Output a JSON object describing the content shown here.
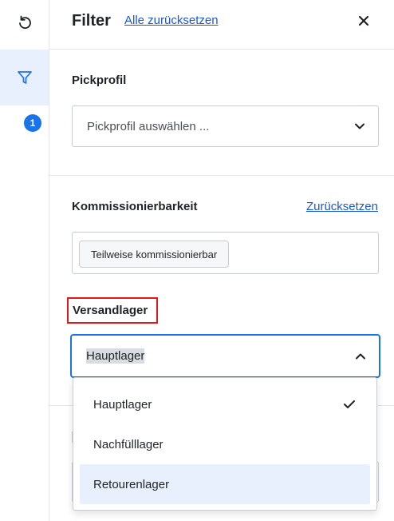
{
  "rail": {
    "undo_icon": "undo-icon",
    "filter_icon": "filter-icon",
    "filter_badge": "1"
  },
  "header": {
    "title": "Filter",
    "reset_all": "Alle zurücksetzen",
    "close_icon": "close-icon"
  },
  "pickprofil": {
    "label": "Pickprofil",
    "placeholder": "Pickprofil auswählen ..."
  },
  "kommissionierbarkeit": {
    "label": "Kommissionierbarkeit",
    "reset": "Zurücksetzen",
    "chip": "Teilweise kommissionierbar"
  },
  "versandlager": {
    "label": "Versandlager",
    "selected": "Hauptlager",
    "options": [
      {
        "label": "Hauptlager",
        "selected": true
      },
      {
        "label": "Nachfülllager",
        "selected": false
      },
      {
        "label": "Retourenlager",
        "selected": false
      }
    ]
  },
  "colors": {
    "accent": "#1a73e8",
    "link": "#1a56db",
    "highlight_border": "#e0191b",
    "hover_bg": "#e9f0fd"
  }
}
